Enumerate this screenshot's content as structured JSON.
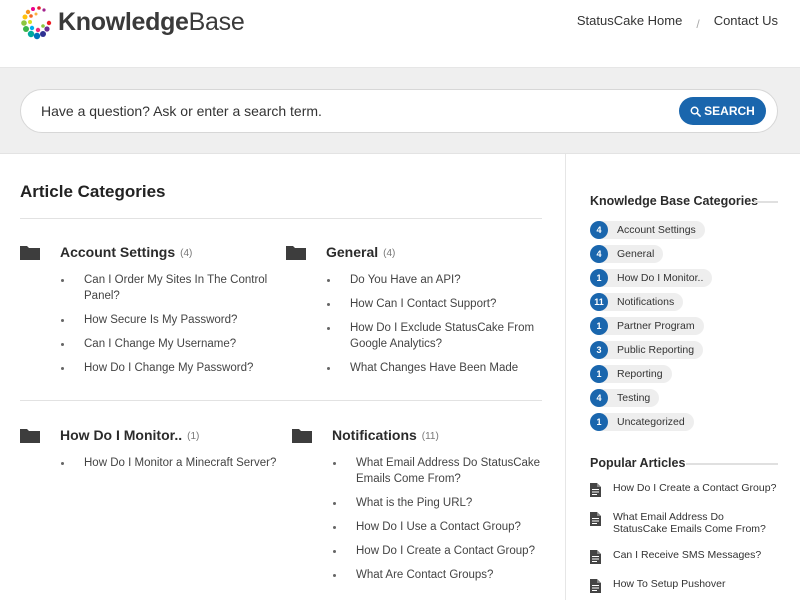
{
  "header": {
    "logo_bold": "Knowledge",
    "logo_light": "Base",
    "nav": [
      {
        "label": "StatusCake Home"
      },
      {
        "label": "Contact Us"
      }
    ],
    "nav_separator": "/"
  },
  "search": {
    "placeholder": "Have a question? Ask or enter a search term.",
    "button_label": "SEARCH"
  },
  "main": {
    "title": "Article Categories",
    "categories": [
      {
        "title": "Account Settings",
        "count": "(4)",
        "articles": [
          "Can I Order My Sites In The Control Panel?",
          "How Secure Is My Password?",
          "Can I Change My Username?",
          "How Do I Change My Password?"
        ]
      },
      {
        "title": "General",
        "count": "(4)",
        "articles": [
          "Do You Have an API?",
          "How Can I Contact Support?",
          "How Do I Exclude StatusCake From Google Analytics?",
          "What Changes Have Been Made"
        ]
      },
      {
        "title": "How Do I Monitor..",
        "count": "(1)",
        "articles": [
          "How Do I Monitor a Minecraft Server?"
        ]
      },
      {
        "title": "Notifications",
        "count": "(11)",
        "articles": [
          "What Email Address Do StatusCake Emails Come From?",
          "What is the Ping URL?",
          "How Do I Use a Contact Group?",
          "How Do I Create a Contact Group?",
          "What Are Contact Groups?"
        ]
      }
    ]
  },
  "sidebar": {
    "kb_title": "Knowledge Base Categories",
    "categories": [
      {
        "count": "4",
        "label": "Account Settings"
      },
      {
        "count": "4",
        "label": "General"
      },
      {
        "count": "1",
        "label": "How Do I Monitor.."
      },
      {
        "count": "11",
        "label": "Notifications"
      },
      {
        "count": "1",
        "label": "Partner Program"
      },
      {
        "count": "3",
        "label": "Public Reporting"
      },
      {
        "count": "1",
        "label": "Reporting"
      },
      {
        "count": "4",
        "label": "Testing"
      },
      {
        "count": "1",
        "label": "Uncategorized"
      }
    ],
    "popular_title": "Popular Articles",
    "popular": [
      "How Do I Create a Contact Group?",
      "What Email Address Do StatusCake Emails Come From?",
      "Can I Receive SMS Messages?",
      "How To Setup Pushover"
    ]
  },
  "colors": {
    "accent": "#1a66ad",
    "search_band": "#efefef",
    "pill": "#eeeeee"
  },
  "icons": {
    "logo": "colorful-dots-ring-icon",
    "category": "folder-icon",
    "search": "magnifier-icon",
    "article": "document-icon"
  }
}
